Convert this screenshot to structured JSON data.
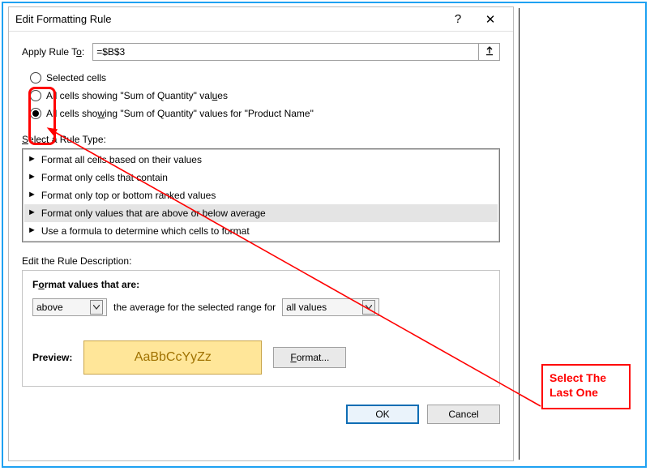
{
  "dialog": {
    "title": "Edit Formatting Rule",
    "help_glyph": "?",
    "close_glyph": "✕"
  },
  "apply": {
    "label_pre": "Apply Rule T",
    "label_u": "o",
    "label_post": ":",
    "value": "=$B$3"
  },
  "radios": {
    "r1_label": "Selected cells",
    "r2_pre": "All cells showing \"Sum of Quantity\" val",
    "r2_u": "u",
    "r2_post": "es",
    "r3_pre": "All cells sho",
    "r3_u": "w",
    "r3_post": "ing \"Sum of Quantity\" values for \"Product Name\"",
    "selected": 3
  },
  "rule_type": {
    "label_pre": "",
    "label_u": "S",
    "label_post": "elect a Rule Type:",
    "items": [
      "Format all cells based on their values",
      "Format only cells that contain",
      "Format only top or bottom ranked values",
      "Format only values that are above or below average",
      "Use a formula to determine which cells to format"
    ],
    "selected_index": 3
  },
  "description": {
    "section_label": "Edit the Rule Description:",
    "title_pre": "F",
    "title_u": "o",
    "title_post": "rmat values that are:",
    "combo1_value": "above",
    "mid_text": "the average for the selected range for",
    "combo2_value": "all values",
    "preview_label": "Preview:",
    "preview_text": "AaBbCcYyZz",
    "format_label": "Format...",
    "format_u": "F"
  },
  "buttons": {
    "ok": "OK",
    "cancel": "Cancel"
  },
  "annotation": {
    "line1": "Select The",
    "line2": "Last One"
  }
}
